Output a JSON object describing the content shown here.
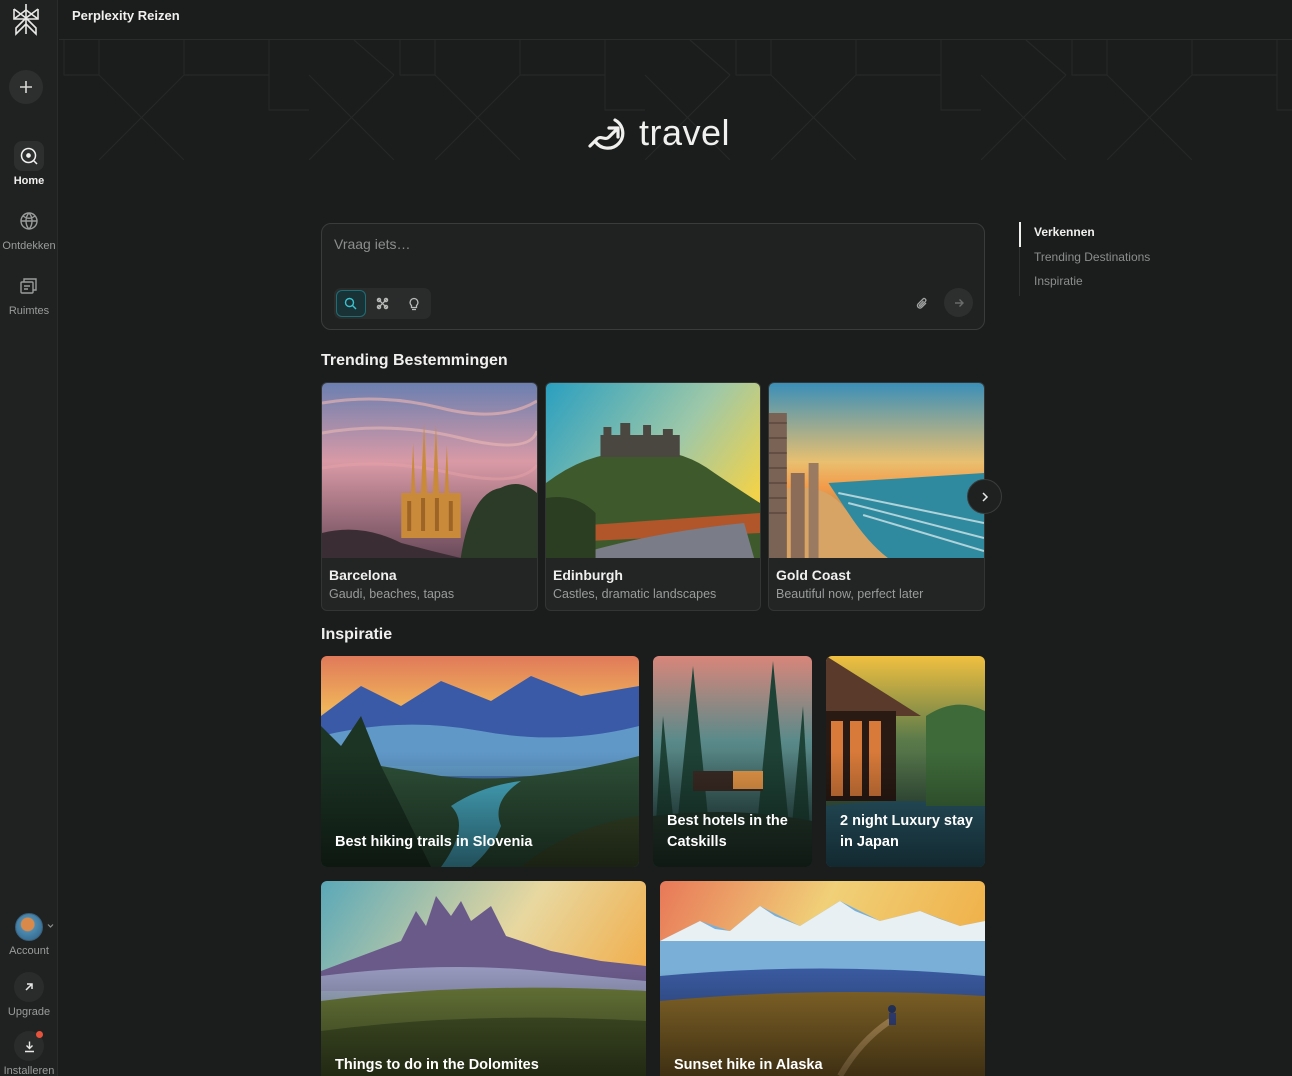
{
  "app": {
    "title": "Perplexity Reizen"
  },
  "sidebar": {
    "items": [
      {
        "label": "Home",
        "icon": "home-search-icon",
        "active": true
      },
      {
        "label": "Ontdekken",
        "icon": "globe-icon",
        "active": false
      },
      {
        "label": "Ruimtes",
        "icon": "spaces-icon",
        "active": false
      }
    ],
    "account_label": "Account",
    "upgrade_label": "Upgrade",
    "install_label": "Installeren"
  },
  "hero": {
    "brand_text": "travel"
  },
  "search": {
    "placeholder": "Vraag iets…",
    "modes": [
      "search-icon",
      "research-icon",
      "lightbulb-icon"
    ]
  },
  "toc": {
    "items": [
      "Verkennen",
      "Trending Destinations",
      "Inspiratie"
    ]
  },
  "trending": {
    "title": "Trending Bestemmingen",
    "cards": [
      {
        "name": "Barcelona",
        "desc": "Gaudi, beaches, tapas"
      },
      {
        "name": "Edinburgh",
        "desc": "Castles, dramatic landscapes"
      },
      {
        "name": "Gold Coast",
        "desc": "Beautiful now, perfect later"
      }
    ]
  },
  "inspiration": {
    "title": "Inspiratie",
    "cards": [
      {
        "caption": "Best hiking trails in Slovenia"
      },
      {
        "caption": "Best hotels in the Catskills"
      },
      {
        "caption": "2 night Luxury stay in Japan"
      },
      {
        "caption": "Things to do in the Dolomites"
      },
      {
        "caption": "Sunset hike in Alaska"
      }
    ]
  },
  "colors": {
    "accent": "#1f6d76",
    "background": "#1b1c1c",
    "sidebar": "#202222",
    "notification": "#e5533c"
  }
}
